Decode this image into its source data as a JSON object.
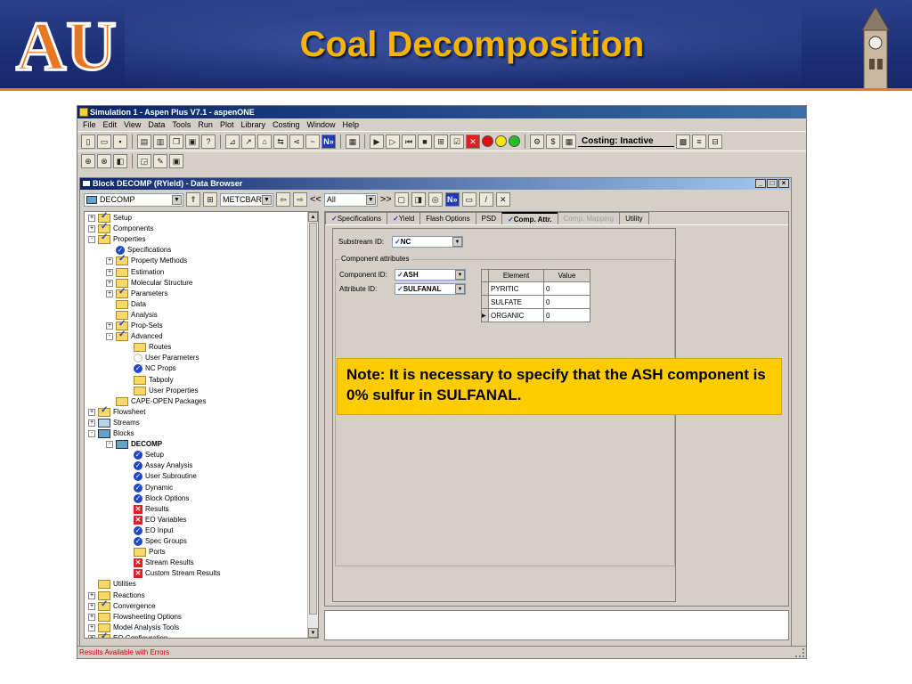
{
  "slide": {
    "title": "Coal Decomposition",
    "note": "Note: It is necessary to specify that the ASH component is 0% sulfur in SULFANAL.",
    "logo_text": "AU",
    "colors": {
      "banner": "#1d2f75",
      "title": "#f6b400",
      "note_bg": "#ffcc00",
      "accent": "#e87722"
    }
  },
  "app": {
    "title": "Simulation 1 - Aspen Plus V7.1 - aspenONE",
    "menu": [
      "File",
      "Edit",
      "View",
      "Data",
      "Tools",
      "Run",
      "Plot",
      "Library",
      "Costing",
      "Window",
      "Help"
    ],
    "costing_label": "Costing: Inactive",
    "status": "Results Available with Errors"
  },
  "browser": {
    "title": "Block DECOMP (RYield) - Data Browser",
    "block_select": "DECOMP",
    "units_select": "METCBAR",
    "filter_select": "All",
    "nav_back": "<<",
    "nav_fwd": ">>"
  },
  "tree": [
    {
      "label": "Setup",
      "icon": "folder-check",
      "pm": "+",
      "indent": 0
    },
    {
      "label": "Components",
      "icon": "folder-check",
      "pm": "+",
      "indent": 0
    },
    {
      "label": "Properties",
      "icon": "folder-check",
      "pm": "-",
      "indent": 0
    },
    {
      "label": "Specifications",
      "icon": "check",
      "pm": "",
      "indent": 1
    },
    {
      "label": "Property Methods",
      "icon": "folder-check",
      "pm": "+",
      "indent": 1
    },
    {
      "label": "Estimation",
      "icon": "folder",
      "pm": "+",
      "indent": 1
    },
    {
      "label": "Molecular Structure",
      "icon": "folder",
      "pm": "+",
      "indent": 1
    },
    {
      "label": "Parameters",
      "icon": "folder-check",
      "pm": "+",
      "indent": 1
    },
    {
      "label": "Data",
      "icon": "folder",
      "pm": "",
      "indent": 1
    },
    {
      "label": "Analysis",
      "icon": "folder",
      "pm": "",
      "indent": 1
    },
    {
      "label": "Prop-Sets",
      "icon": "folder-check",
      "pm": "+",
      "indent": 1
    },
    {
      "label": "Advanced",
      "icon": "folder-check",
      "pm": "-",
      "indent": 1
    },
    {
      "label": "Routes",
      "icon": "folder",
      "pm": "",
      "indent": 2
    },
    {
      "label": "User Parameters",
      "icon": "empty",
      "pm": "",
      "indent": 2
    },
    {
      "label": "NC Props",
      "icon": "check",
      "pm": "",
      "indent": 2
    },
    {
      "label": "Tabpoly",
      "icon": "folder",
      "pm": "",
      "indent": 2
    },
    {
      "label": "User Properties",
      "icon": "folder",
      "pm": "",
      "indent": 2
    },
    {
      "label": "CAPE-OPEN Packages",
      "icon": "folder",
      "pm": "",
      "indent": 1
    },
    {
      "label": "Flowsheet",
      "icon": "folder-check",
      "pm": "+",
      "indent": 0
    },
    {
      "label": "Streams",
      "icon": "stream",
      "pm": "+",
      "indent": 0
    },
    {
      "label": "Blocks",
      "icon": "block",
      "pm": "-",
      "indent": 0
    },
    {
      "label": "DECOMP",
      "icon": "block",
      "pm": "-",
      "indent": 1,
      "bold": true
    },
    {
      "label": "Setup",
      "icon": "check",
      "pm": "",
      "indent": 2
    },
    {
      "label": "Assay Analysis",
      "icon": "check",
      "pm": "",
      "indent": 2
    },
    {
      "label": "User Subroutine",
      "icon": "check",
      "pm": "",
      "indent": 2
    },
    {
      "label": "Dynamic",
      "icon": "check",
      "pm": "",
      "indent": 2
    },
    {
      "label": "Block Options",
      "icon": "check",
      "pm": "",
      "indent": 2
    },
    {
      "label": "Results",
      "icon": "x",
      "pm": "",
      "indent": 2
    },
    {
      "label": "EO Variables",
      "icon": "x",
      "pm": "",
      "indent": 2
    },
    {
      "label": "EO Input",
      "icon": "check",
      "pm": "",
      "indent": 2
    },
    {
      "label": "Spec Groups",
      "icon": "check",
      "pm": "",
      "indent": 2
    },
    {
      "label": "Ports",
      "icon": "folder",
      "pm": "",
      "indent": 2
    },
    {
      "label": "Stream Results",
      "icon": "x",
      "pm": "",
      "indent": 2
    },
    {
      "label": "Custom Stream Results",
      "icon": "x",
      "pm": "",
      "indent": 2
    },
    {
      "label": "Utilities",
      "icon": "folder",
      "pm": "",
      "indent": 0
    },
    {
      "label": "Reactions",
      "icon": "folder",
      "pm": "+",
      "indent": 0
    },
    {
      "label": "Convergence",
      "icon": "folder-check",
      "pm": "+",
      "indent": 0
    },
    {
      "label": "Flowsheeting Options",
      "icon": "folder",
      "pm": "+",
      "indent": 0
    },
    {
      "label": "Model Analysis Tools",
      "icon": "folder",
      "pm": "+",
      "indent": 0
    },
    {
      "label": "EO Configuration",
      "icon": "folder-check",
      "pm": "+",
      "indent": 0
    }
  ],
  "tabs": [
    {
      "label": "Specifications",
      "tick": true,
      "state": "normal"
    },
    {
      "label": "Yield",
      "tick": true,
      "state": "normal"
    },
    {
      "label": "Flash Options",
      "tick": false,
      "state": "normal"
    },
    {
      "label": "PSD",
      "tick": false,
      "state": "normal"
    },
    {
      "label": "Comp. Attr.",
      "tick": true,
      "state": "active"
    },
    {
      "label": "Comp. Mapping",
      "tick": false,
      "state": "disabled"
    },
    {
      "label": "Utility",
      "tick": false,
      "state": "normal"
    }
  ],
  "form": {
    "substream_label": "Substream ID:",
    "substream_value": "NC",
    "group_title": "Component attributes",
    "component_label": "Component ID:",
    "component_value": "ASH",
    "attribute_label": "Attribute ID:",
    "attribute_value": "SULFANAL",
    "grid_headers": [
      "Element",
      "Value"
    ],
    "grid_rows": [
      {
        "element": "PYRITIC",
        "value": "0"
      },
      {
        "element": "SULFATE",
        "value": "0"
      },
      {
        "element": "ORGANIC",
        "value": "0"
      }
    ]
  }
}
